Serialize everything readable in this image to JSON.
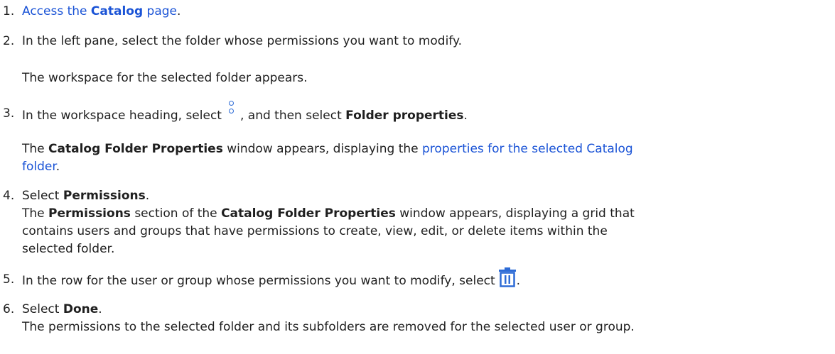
{
  "steps": [
    {
      "num": "1.",
      "pre": "",
      "link_pre": "Access the ",
      "link_bold": "Catalog",
      "link_post": " page",
      "post": "."
    },
    {
      "num": "2.",
      "text": "In the left pane, select the folder whose permissions you want to modify.",
      "result": "The workspace for the selected folder appears."
    },
    {
      "num": "3.",
      "pre": "In the workspace heading, select",
      "mid": ", and then select ",
      "bold": "Folder properties",
      "post": ".",
      "icon": "more-vertical-icon",
      "result_pre": "The ",
      "result_bold": "Catalog Folder Properties",
      "result_mid": " window appears, displaying the ",
      "result_link_line1": "properties for the selected Catalog",
      "result_link_line2": "folder",
      "result_post": "."
    },
    {
      "num": "4.",
      "pre": "Select ",
      "bold": "Permissions",
      "post": ".",
      "r_pre": "The ",
      "r_bold1": "Permissions",
      "r_mid1": " section of the ",
      "r_bold2": "Catalog Folder Properties",
      "r_line1_end": " window appears, displaying a grid that",
      "r_line2": "contains users and groups that have permissions to create, view, edit, or delete items within the",
      "r_line3": "selected folder."
    },
    {
      "num": "5.",
      "pre": "In the row for the user or group whose permissions you want to modify, select",
      "post": ".",
      "icon": "trash-icon"
    },
    {
      "num": "6.",
      "pre": "Select ",
      "bold": "Done",
      "post": ".",
      "result": "The permissions to the selected folder and its subfolders are removed for the selected user or group."
    }
  ],
  "colors": {
    "text": "#1f1f1f",
    "link": "#1a53d6",
    "icon": "#2d6bd6"
  }
}
